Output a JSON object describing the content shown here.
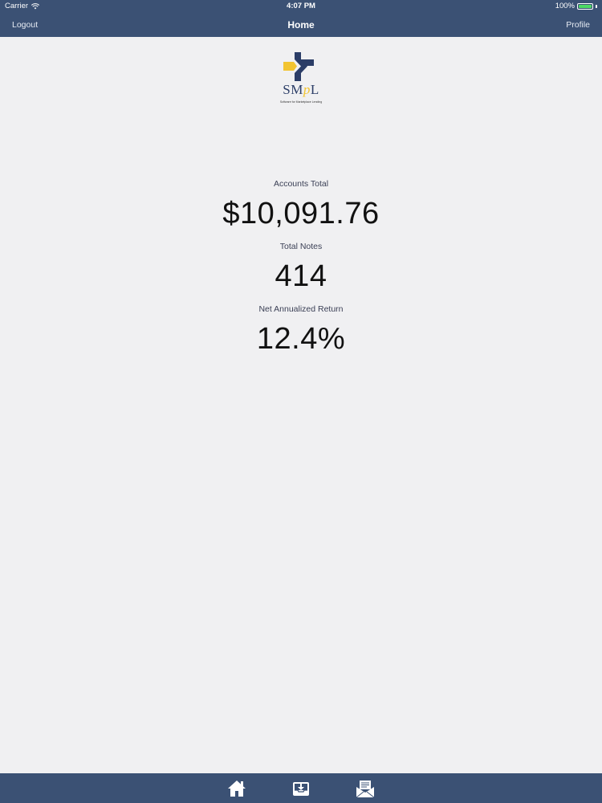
{
  "status_bar": {
    "carrier": "Carrier",
    "time": "4:07 PM",
    "battery": "100%",
    "battery_color": "#4cd964"
  },
  "nav": {
    "left_label": "Logout",
    "title": "Home",
    "right_label": "Profile"
  },
  "logo": {
    "text_s": "SM",
    "text_p": "p",
    "text_l": "L",
    "tagline": "Software for Marketplace Lending"
  },
  "stats": [
    {
      "label": "Accounts Total",
      "value": "$10,091.76"
    },
    {
      "label": "Total Notes",
      "value": "414"
    },
    {
      "label": "Net Annualized Return",
      "value": "12.4%"
    }
  ],
  "tabbar": {
    "icons": [
      "home-icon",
      "inbox-download-icon",
      "open-mail-icon"
    ]
  },
  "colors": {
    "bar_background": "#3b5174",
    "page_background": "#f0f0f2",
    "logo_navy": "#2b3d67",
    "logo_yellow": "#f2c431"
  }
}
